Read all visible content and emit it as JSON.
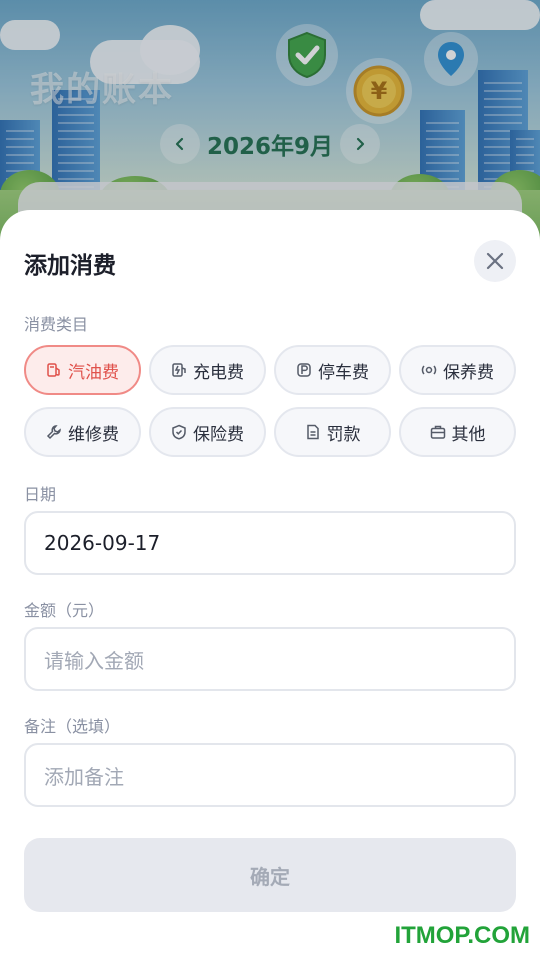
{
  "header": {
    "app_title": "我的账本",
    "month_label": "2026年9月"
  },
  "sheet": {
    "title": "添加消费",
    "category_label": "消费类目",
    "categories": [
      {
        "label": "汽油费",
        "icon": "fuel-icon",
        "active": true
      },
      {
        "label": "充电费",
        "icon": "charging-icon",
        "active": false
      },
      {
        "label": "停车费",
        "icon": "parking-icon",
        "active": false
      },
      {
        "label": "保养费",
        "icon": "maintenance-icon",
        "active": false
      },
      {
        "label": "维修费",
        "icon": "wrench-icon",
        "active": false
      },
      {
        "label": "保险费",
        "icon": "shield-icon",
        "active": false
      },
      {
        "label": "罚款",
        "icon": "document-icon",
        "active": false
      },
      {
        "label": "其他",
        "icon": "briefcase-icon",
        "active": false
      }
    ],
    "date_label": "日期",
    "date_value": "2026-09-17",
    "amount_label": "金额（元）",
    "amount_placeholder": "请输入金额",
    "note_label": "备注（选填）",
    "note_placeholder": "添加备注",
    "confirm_label": "确定"
  },
  "watermark": "ITMOP.COM",
  "colors": {
    "accent": "#e0514b",
    "accent_bg": "#fdeceb",
    "month_text": "#1f6e4e",
    "watermark": "#22a339"
  }
}
